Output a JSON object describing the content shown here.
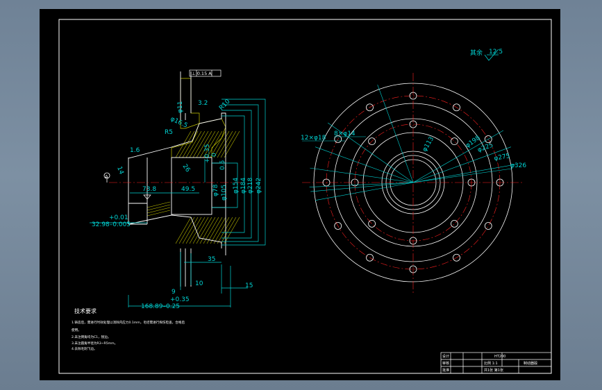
{
  "roughness": {
    "label": "其余",
    "value": "12.5"
  },
  "section_view": {
    "dims": {
      "perp": "⊥ 0.15 A",
      "d11": "φ11",
      "d32": "3.2",
      "r10": "R10",
      "ph16": "φ16.5",
      "r5": "R5",
      "d16": "1.6",
      "d14": "14",
      "a": "A",
      "d26": "26",
      "tol_up1": "+0.35",
      "tol_lo1": "0",
      "d78": "φ78",
      "d105": "φ105",
      "d154": "φ154",
      "d184": "φ184",
      "d218": "φ218",
      "d242": "φ242",
      "d05": "0.5",
      "d738": "73.8",
      "d495": "49.5",
      "tol_up2": "+0.01",
      "d3298": "32.98–0.005",
      "d35": "35",
      "d9": "9",
      "d10": "10",
      "d15": "15",
      "tol_up3": "+0.35",
      "d16899": "168.89–0.25"
    }
  },
  "front_view": {
    "holes_label": "12×φ18",
    "thread_label": "8×φ14",
    "dims": {
      "d113": "φ113",
      "d198": "φ198",
      "d225": "φ225",
      "d275": "φ275",
      "d326": "φ326"
    }
  },
  "tech_req": {
    "title": "技术要求",
    "items": [
      "1.铸造后，需进行时效处理以消除内应力0.1mm，毛坯需进行探伤检查，合格后",
      "   使用。",
      "2.未注倒角均为C1，锐边。",
      "3.未注圆角半径为R3~R5mm。",
      "4.去除毛刺飞边。"
    ]
  },
  "title_block": {
    "drawing_no": "HT200",
    "part_name": "制动器毂",
    "scale": "比例 1:1",
    "cells": [
      "设计",
      "审核",
      "批准"
    ],
    "sheet": "共1张  第1张"
  },
  "colors": {
    "background": "#000000",
    "outline": "#ffffff",
    "dimension": "#00d4d4",
    "centerline": "#ff2020",
    "hatch": "#c8c800",
    "leader": "#ffffff"
  }
}
